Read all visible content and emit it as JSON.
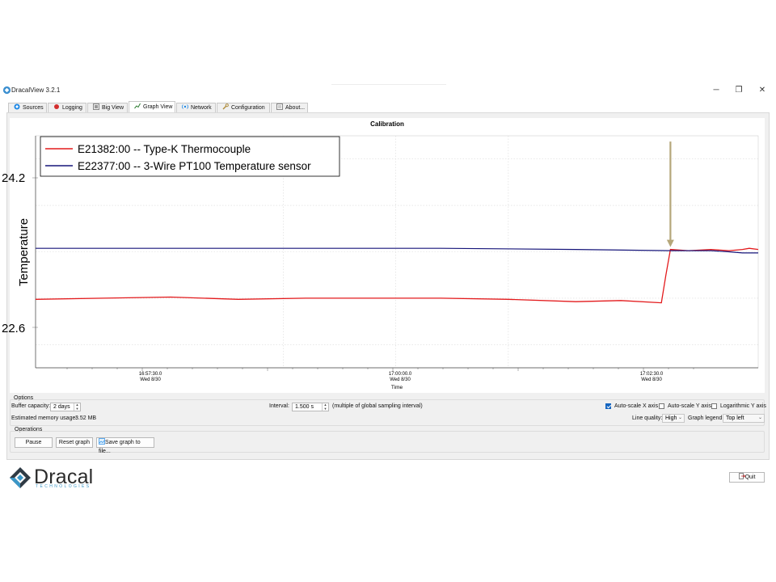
{
  "window": {
    "title": "DracalView 3.2.1",
    "controls": {
      "minimize": "─",
      "restore": "❐",
      "close": "✕"
    }
  },
  "tabs": [
    {
      "label": "Sources",
      "icon": "sources-icon",
      "active": false
    },
    {
      "label": "Logging",
      "icon": "record-icon",
      "active": false
    },
    {
      "label": "Big View",
      "icon": "big-view-icon",
      "active": false
    },
    {
      "label": "Graph View",
      "icon": "graph-icon",
      "active": true
    },
    {
      "label": "Network",
      "icon": "network-icon",
      "active": false
    },
    {
      "label": "Configuration",
      "icon": "wrench-icon",
      "active": false
    },
    {
      "label": "About...",
      "icon": "about-icon",
      "active": false
    }
  ],
  "chart_data": {
    "type": "line",
    "title": "Calibration",
    "xlabel": "Time",
    "ylabel": "Temperature",
    "yticks": [
      "24.2",
      "22.6"
    ],
    "xticks": [
      {
        "time": "16:57:30.0",
        "date": "Wed 8/30"
      },
      {
        "time": "17:00:00.0",
        "date": "Wed 8/30"
      },
      {
        "time": "17:02:30.0",
        "date": "Wed 8/30"
      }
    ],
    "xlim_seconds": [
      -13,
      3.05
    ],
    "ylim": [
      22.4,
      24.4
    ],
    "grid": true,
    "legend_position": "top-left",
    "series": [
      {
        "name": "E21382:00 -- Type-K Thermocouple",
        "color": "#e31a1c",
        "x": [
          -13,
          -11.5,
          -10,
          -8.5,
          -7,
          -5.5,
          -4,
          -2.5,
          -1,
          0,
          0.9,
          1.0,
          1.1,
          1.5,
          2.0,
          2.4,
          2.7,
          2.85,
          3.05
        ],
        "y": [
          22.99,
          23.0,
          23.01,
          22.99,
          23.0,
          23.0,
          23.0,
          22.99,
          22.97,
          22.98,
          22.96,
          23.2,
          23.42,
          23.41,
          23.42,
          23.41,
          23.42,
          23.43,
          23.42
        ]
      },
      {
        "name": "E22377:00 -- 3-Wire PT100 Temperature sensor",
        "color": "#16157a",
        "x": [
          -13,
          -10,
          -7,
          -4,
          -1,
          1.1,
          1.5,
          2.0,
          2.4,
          2.7,
          3.05
        ],
        "y": [
          23.43,
          23.43,
          23.43,
          23.43,
          23.42,
          23.41,
          23.41,
          23.41,
          23.4,
          23.39,
          23.39
        ]
      }
    ],
    "annotation": {
      "type": "arrow",
      "color": "#b5a77a",
      "x": 1.1,
      "y": 23.42,
      "y_top": 24.35
    }
  },
  "options": {
    "group_label": "Options",
    "buffer_capacity": {
      "label": "Buffer capacity:",
      "value": "2 days"
    },
    "interval": {
      "label": "Interval:",
      "value": "1.500 s",
      "note": "(multiple of global sampling interval)"
    },
    "autoscale_x": {
      "label": "Auto-scale X axis",
      "checked": true
    },
    "autoscale_y": {
      "label": "Auto-scale Y axis",
      "checked": false
    },
    "log_y": {
      "label": "Logarithmic Y axis",
      "checked": false
    },
    "memory": {
      "label": "Estimated memory usage:",
      "value": "3.52 MB"
    },
    "line_quality": {
      "label": "Line quality:",
      "value": "High"
    },
    "graph_legend": {
      "label": "Graph legend:",
      "value": "Top left"
    }
  },
  "operations": {
    "group_label": "Operations",
    "pause": "Pause",
    "reset": "Reset graph",
    "save": "Save graph to file..."
  },
  "footer": {
    "logo_text": "Dracal",
    "logo_sub": "TECHNOLOGIES",
    "quit": "Quit"
  },
  "colors": {
    "accent": "#1565c0",
    "logo_blue": "#3b97c7"
  }
}
